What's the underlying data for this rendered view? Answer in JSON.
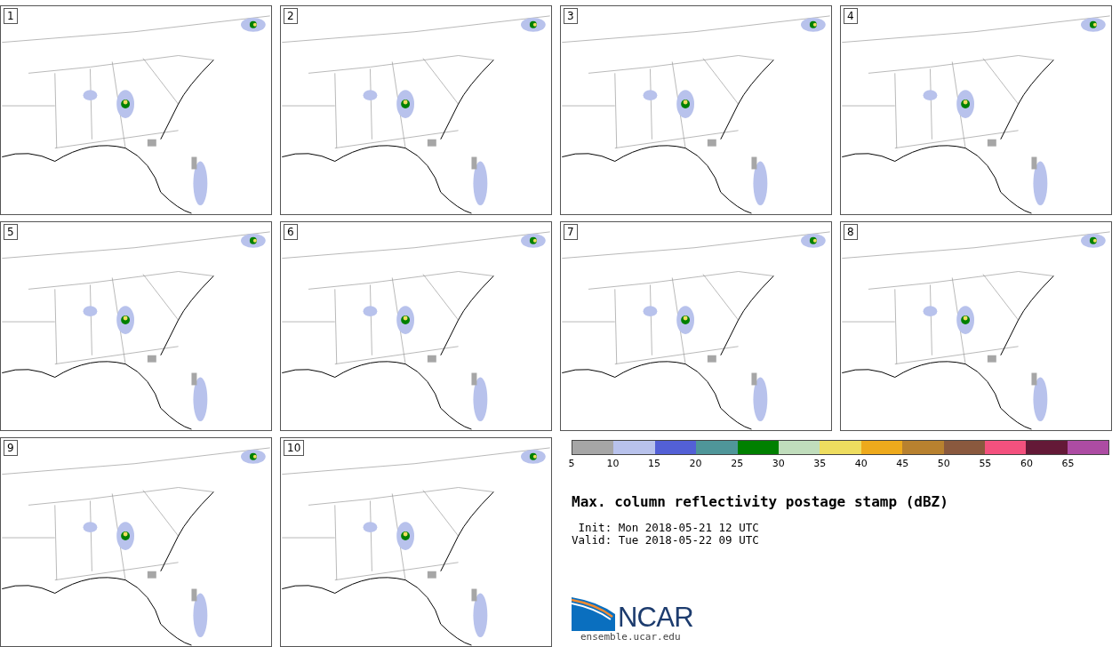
{
  "panels": [
    {
      "label": "1"
    },
    {
      "label": "2"
    },
    {
      "label": "3"
    },
    {
      "label": "4"
    },
    {
      "label": "5"
    },
    {
      "label": "6"
    },
    {
      "label": "7"
    },
    {
      "label": "8"
    },
    {
      "label": "9"
    },
    {
      "label": "10"
    }
  ],
  "colorbar": {
    "bins": [
      {
        "color": "#a6a6a6"
      },
      {
        "color": "#b8c2ec"
      },
      {
        "color": "#5360d6"
      },
      {
        "color": "#4f9699"
      },
      {
        "color": "#008000"
      },
      {
        "color": "#c0ddbc"
      },
      {
        "color": "#eedd5f"
      },
      {
        "color": "#eeaa1c"
      },
      {
        "color": "#b8812f"
      },
      {
        "color": "#8a593e"
      },
      {
        "color": "#f4517e"
      },
      {
        "color": "#641937"
      },
      {
        "color": "#ad4ca3"
      }
    ],
    "ticks": [
      "5",
      "10",
      "15",
      "20",
      "25",
      "30",
      "35",
      "40",
      "45",
      "50",
      "55",
      "60",
      "65"
    ]
  },
  "title": "Max. column reflectivity postage stamp (dBZ)",
  "init": " Init: Mon 2018-05-21 12 UTC",
  "valid": "Valid: Tue 2018-05-22 09 UTC",
  "logo": {
    "text": "NCAR",
    "url": "ensemble.ucar.edu"
  }
}
